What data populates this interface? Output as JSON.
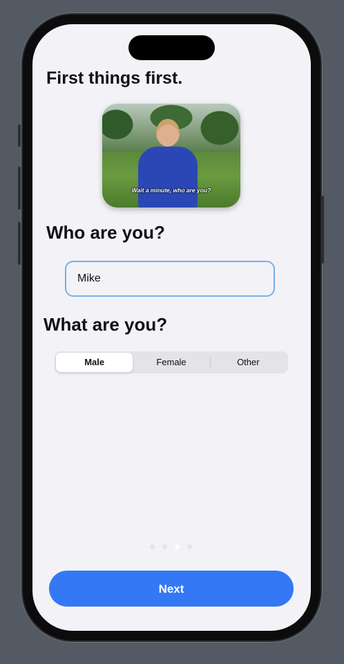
{
  "screen": {
    "title": "First things first.",
    "gif_caption": "Wait a minute, who are you?",
    "who_heading": "Who are you?",
    "name_value": "Mike",
    "what_heading": "What are you?",
    "segments": [
      {
        "label": "Male",
        "selected": true
      },
      {
        "label": "Female",
        "selected": false
      },
      {
        "label": "Other",
        "selected": false
      }
    ],
    "page_indicator": {
      "total": 4,
      "current": 3
    },
    "next_label": "Next"
  },
  "colors": {
    "accent": "#3478f6",
    "background": "#f2f2f7",
    "field_border": "#7aaee8"
  }
}
